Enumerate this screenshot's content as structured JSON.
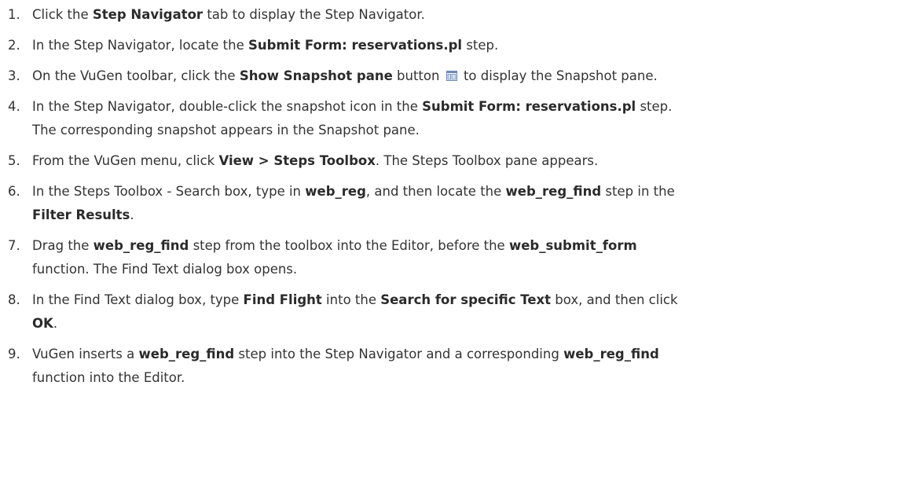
{
  "steps": [
    {
      "number": "1.",
      "parts": [
        {
          "t": "Click the "
        },
        {
          "t": "Step Navigator",
          "b": true
        },
        {
          "t": " tab to display the Step Navigator."
        }
      ]
    },
    {
      "number": "2.",
      "parts": [
        {
          "t": "In the Step Navigator, locate the "
        },
        {
          "t": "Submit Form: reservations.pl",
          "b": true
        },
        {
          "t": " step."
        }
      ]
    },
    {
      "number": "3.",
      "parts": [
        {
          "t": "On the VuGen toolbar, click the "
        },
        {
          "t": "Show Snapshot pane",
          "b": true
        },
        {
          "t": " button "
        },
        {
          "icon": "show-snapshot-pane-icon"
        },
        {
          "t": " to display the Snapshot pane."
        }
      ]
    },
    {
      "number": "4.",
      "parts": [
        {
          "t": "In the Step Navigator, double-click the snapshot icon in the "
        },
        {
          "t": "Submit Form: reservations.pl",
          "b": true
        },
        {
          "t": " step."
        },
        {
          "br": true
        },
        {
          "t": "The corresponding snapshot appears in the Snapshot pane."
        }
      ]
    },
    {
      "number": "5.",
      "parts": [
        {
          "t": "From the VuGen menu, click "
        },
        {
          "t": "View > Steps Toolbox",
          "b": true
        },
        {
          "t": ". The Steps Toolbox pane appears."
        }
      ]
    },
    {
      "number": "6.",
      "parts": [
        {
          "t": "In the Steps Toolbox - Search box, type in "
        },
        {
          "t": "web_reg",
          "b": true
        },
        {
          "t": ", and then locate the "
        },
        {
          "t": "web_reg_find",
          "b": true
        },
        {
          "t": " step in the"
        },
        {
          "br": true
        },
        {
          "t": "Filter Results",
          "b": true
        },
        {
          "t": "."
        }
      ]
    },
    {
      "number": "7.",
      "parts": [
        {
          "t": "Drag the "
        },
        {
          "t": "web_reg_find",
          "b": true
        },
        {
          "t": " step from the toolbox into the Editor, before the "
        },
        {
          "t": "web_submit_form",
          "b": true
        },
        {
          "br": true
        },
        {
          "t": "function. The Find Text dialog box opens."
        }
      ]
    },
    {
      "number": "8.",
      "parts": [
        {
          "t": "In the Find Text dialog box, type "
        },
        {
          "t": "Find Flight",
          "b": true
        },
        {
          "t": " into the "
        },
        {
          "t": "Search for specific Text",
          "b": true
        },
        {
          "t": " box, and then click"
        },
        {
          "br": true
        },
        {
          "t": "OK",
          "b": true
        },
        {
          "t": "."
        }
      ]
    },
    {
      "number": "9.",
      "parts": [
        {
          "t": "VuGen inserts a "
        },
        {
          "t": "web_reg_find",
          "b": true
        },
        {
          "t": " step into the Step Navigator and a corresponding "
        },
        {
          "t": "web_reg_find",
          "b": true
        },
        {
          "br": true
        },
        {
          "t": "function into the Editor."
        }
      ]
    }
  ],
  "colors": {
    "text": "#333333",
    "icon_frame": "#6b8bb5",
    "icon_fill": "#cfe0f4"
  }
}
